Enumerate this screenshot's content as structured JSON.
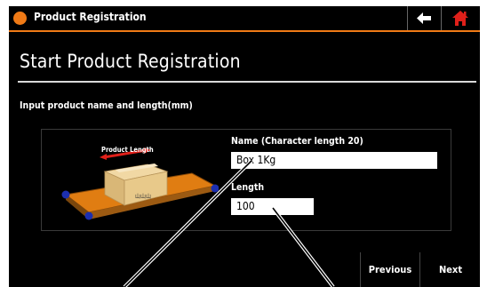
{
  "window": {
    "title": "Product Registration",
    "accent": "#f07a16",
    "background": "#000000",
    "home_color": "#e0201a"
  },
  "header_buttons": {
    "back_icon": "arrow-left",
    "home_icon": "house"
  },
  "page": {
    "heading": "Start Product Registration",
    "instruction": "Input product name and length(mm)"
  },
  "illustration": {
    "label": "Product Length",
    "box_text": "山山山"
  },
  "form": {
    "name_label": "Name (Character length 20)",
    "name_value": "Box 1Kg",
    "length_label": "Length",
    "length_value": "100"
  },
  "footer": {
    "previous_label": "Previous",
    "next_label": "Next"
  }
}
